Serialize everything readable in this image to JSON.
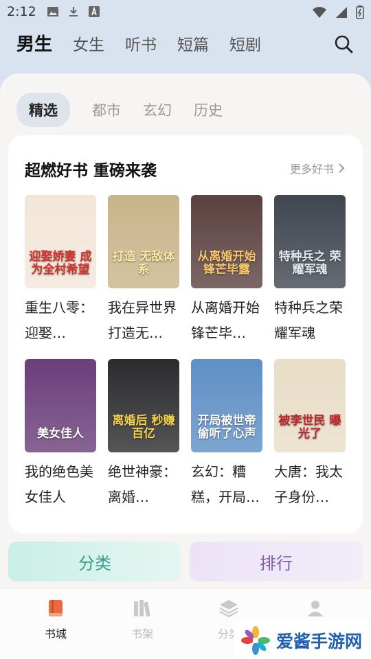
{
  "status": {
    "time": "2:12"
  },
  "top_tabs": [
    "男生",
    "女生",
    "听书",
    "短篇",
    "短剧"
  ],
  "sub_tabs": [
    "精选",
    "都市",
    "玄幻",
    "历史"
  ],
  "section": {
    "title": "超燃好书 重磅来袭",
    "more": "更多好书"
  },
  "books": [
    {
      "title": "重生八零：迎娶…",
      "cover_text": "迎娶娇妻 成为全村希望",
      "bg": "#f3e6d9",
      "fg": "#d0332b"
    },
    {
      "title": "我在异世界打造无…",
      "cover_text": "打造 无敌体系",
      "bg": "#c9b48a",
      "fg": "#ffe9a6"
    },
    {
      "title": "从离婚开始锋芒毕…",
      "cover_text": "从离婚开始 锋芒毕露",
      "bg": "#5b4140",
      "fg": "#f6c86a"
    },
    {
      "title": "特种兵之荣耀军魂",
      "cover_text": "特种兵之 荣耀军魂",
      "bg": "#3f4650",
      "fg": "#e3e8ee"
    },
    {
      "title": "我的绝色美女佳人",
      "cover_text": "美女佳人",
      "bg": "#6a3e7a",
      "fg": "#ffffff"
    },
    {
      "title": "绝世神豪：离婚…",
      "cover_text": "离婚后 秒赚百亿",
      "bg": "#2b2a2c",
      "fg": "#f3d34a"
    },
    {
      "title": "玄幻：糟糕，开局…",
      "cover_text": "开局被世帝 偷听了心声",
      "bg": "#5e8fc6",
      "fg": "#ffffff"
    },
    {
      "title": "大唐：我太子身份…",
      "cover_text": "被李世民 曝光了",
      "bg": "#e8ddc6",
      "fg": "#c1272d"
    }
  ],
  "buttons": {
    "category": "分类",
    "rank": "排行"
  },
  "nav": [
    "书城",
    "书架",
    "分类",
    ""
  ],
  "watermark": "爱酱手游网"
}
